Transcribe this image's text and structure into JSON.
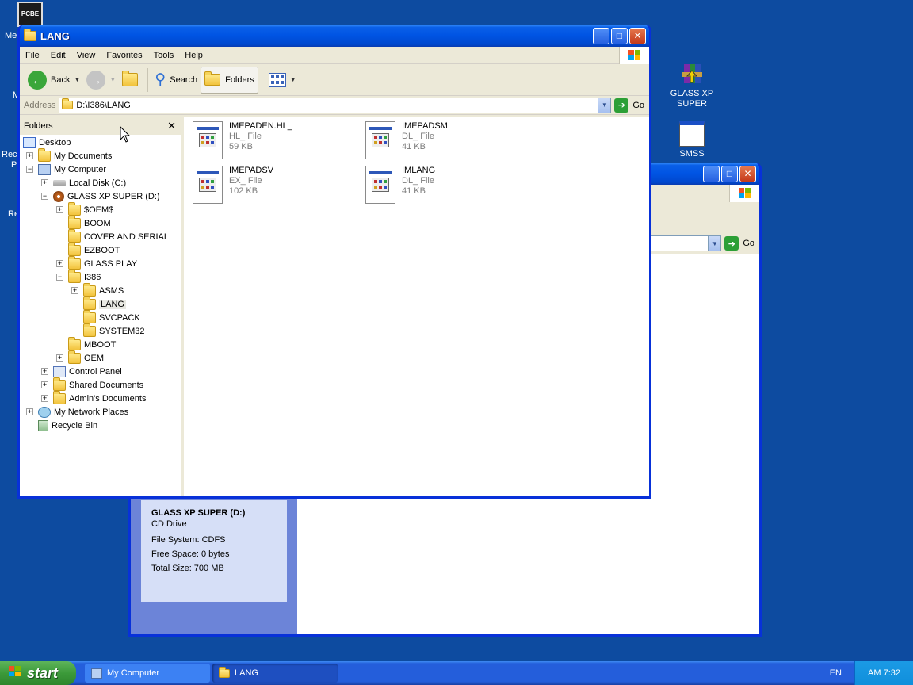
{
  "desktop": {
    "icons": {
      "glass_label": "GLASS XP SUPER",
      "smss_label": "SMSS",
      "topleft_badge": "PCBE"
    },
    "partial_labels": [
      "Me",
      "M",
      "Recy",
      "Pr",
      "Re"
    ]
  },
  "back_window": {
    "go_label": "Go",
    "details": {
      "name": "GLASS XP SUPER (D:)",
      "type": "CD Drive",
      "filesystem": "File System: CDFS",
      "free": "Free Space: 0 bytes",
      "total": "Total Size: 700 MB"
    }
  },
  "window": {
    "title": "LANG",
    "menu": [
      "File",
      "Edit",
      "View",
      "Favorites",
      "Tools",
      "Help"
    ],
    "toolbar": {
      "back": "Back",
      "search": "Search",
      "folders": "Folders"
    },
    "address": {
      "label": "Address",
      "value": "D:\\I386\\LANG",
      "go": "Go"
    },
    "folders_pane": {
      "title": "Folders",
      "tree": [
        "Desktop",
        "My Documents",
        "My Computer",
        "Local Disk (C:)",
        "GLASS XP SUPER (D:)",
        "$OEM$",
        "BOOM",
        "COVER AND SERIAL",
        "EZBOOT",
        "GLASS PLAY",
        "I386",
        "ASMS",
        "LANG",
        "SVCPACK",
        "SYSTEM32",
        "MBOOT",
        "OEM",
        "Control Panel",
        "Shared Documents",
        "Admin's Documents",
        "My Network Places",
        "Recycle Bin"
      ]
    },
    "files": [
      {
        "name": "IMEPADEN.HL_",
        "type": "HL_ File",
        "size": "59 KB"
      },
      {
        "name": "IMEPADSM",
        "type": "DL_ File",
        "size": "41 KB"
      },
      {
        "name": "IMEPADSV",
        "type": "EX_ File",
        "size": "102 KB"
      },
      {
        "name": "IMLANG",
        "type": "DL_ File",
        "size": "41 KB"
      }
    ]
  },
  "taskbar": {
    "start": "start",
    "tasks": [
      "My Computer",
      "LANG"
    ],
    "lang": "EN",
    "clock": "AM 7:32"
  }
}
